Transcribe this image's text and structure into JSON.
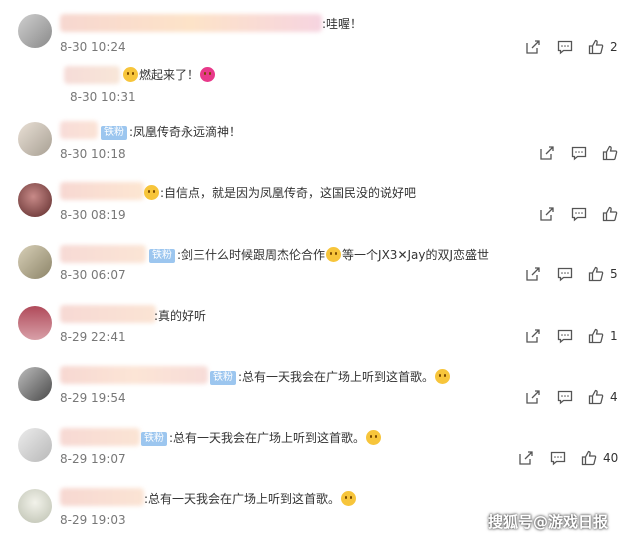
{
  "comments": [
    {
      "text": ":哇喔！",
      "time": "8-30 10:24",
      "badge": "",
      "likes": "2",
      "reply": {
        "text": "燃起来了！",
        "time": "8-30 10:31"
      }
    },
    {
      "text": ":凤凰传奇永远滴神！",
      "time": "8-30 10:18",
      "badge": "铁粉",
      "likes": ""
    },
    {
      "text": ":自信点，就是因为凤凰传奇，这国民没的说好吧",
      "time": "8-30 08:19",
      "badge": "",
      "likes": ""
    },
    {
      "text": ":剑三什么时候跟周杰伦合作",
      "text2": "等一个JX3✕Jay的双J恋盛世",
      "time": "8-30 06:07",
      "badge": "铁粉",
      "likes": "5"
    },
    {
      "text": ":真的好听",
      "time": "8-29 22:41",
      "badge": "",
      "likes": "1"
    },
    {
      "text": ":总有一天我会在广场上听到这首歌。",
      "time": "8-29 19:54",
      "badge": "铁粉",
      "likes": "4"
    },
    {
      "text": ":总有一天我会在广场上听到这首歌。",
      "time": "8-29 19:07",
      "badge": "铁粉",
      "likes": "40"
    },
    {
      "text": ":总有一天我会在广场上听到这首歌。",
      "time": "8-29 19:03",
      "badge": "",
      "likes": ""
    }
  ],
  "watermark": "搜狐号@游戏日报",
  "icons": {
    "share": "share-icon",
    "comment": "comment-icon",
    "like": "thumbs-up-icon"
  }
}
